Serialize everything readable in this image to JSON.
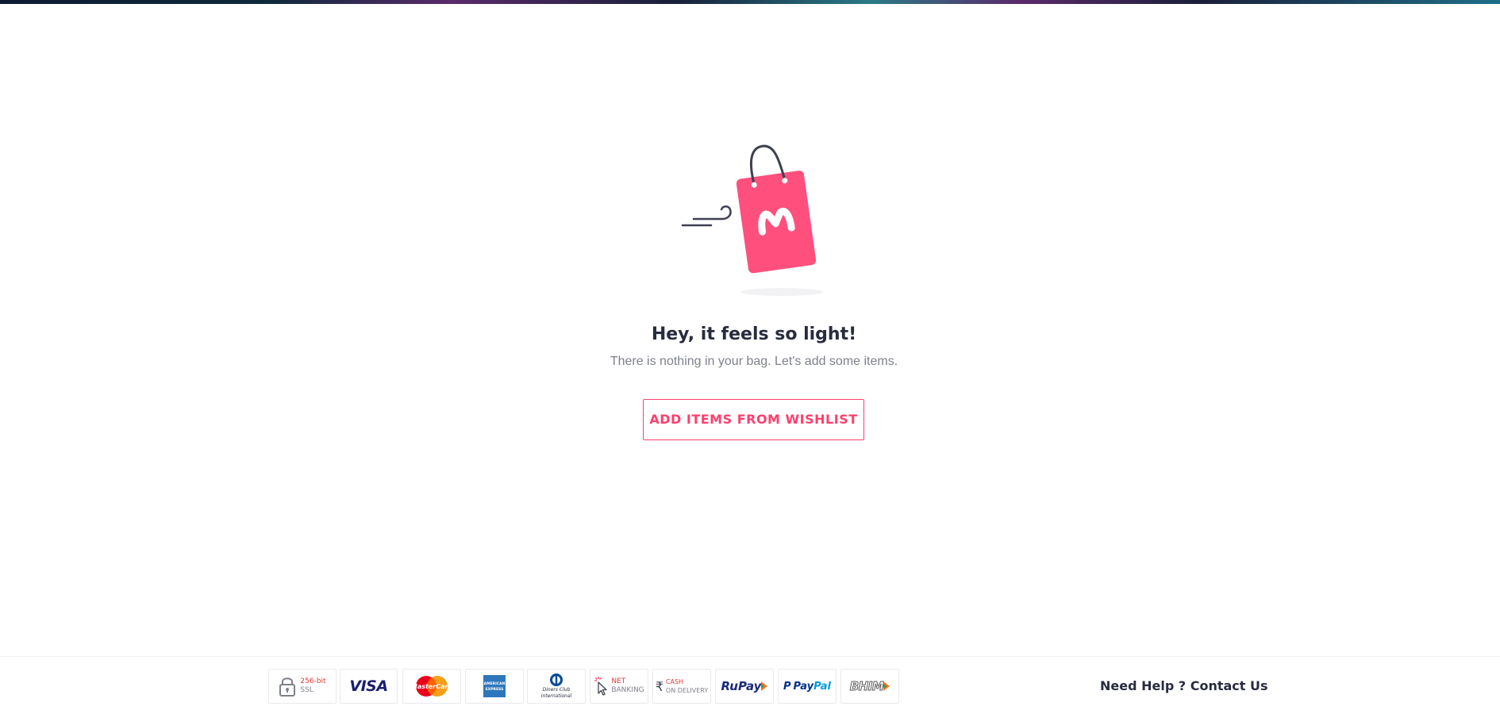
{
  "brand": {
    "accent_color": "#ff3f6c",
    "logo_letter": "M"
  },
  "empty_bag": {
    "illustration_icon": "shopping-bag-icon",
    "headline": "Hey, it feels so light!",
    "subtext": "There is nothing in your bag. Let's add some items.",
    "cta_label": "ADD ITEMS FROM WISHLIST"
  },
  "footer": {
    "payment_badges": [
      {
        "name": "ssl",
        "top": "256-bit",
        "bottom": "SSL"
      },
      {
        "name": "visa",
        "label": "VISA"
      },
      {
        "name": "mastercard",
        "label": "MasterCard"
      },
      {
        "name": "amex",
        "label": "AMERICAN EXPRESS"
      },
      {
        "name": "diners",
        "top": "Diners Club",
        "bottom": "International"
      },
      {
        "name": "netbanking",
        "top": "NET",
        "bottom": "BANKING"
      },
      {
        "name": "cod",
        "top": "CASH",
        "bottom": "ON DELIVERY"
      },
      {
        "name": "rupay",
        "label": "RuPay"
      },
      {
        "name": "paypal",
        "label_a": "Pay",
        "label_b": "Pal"
      },
      {
        "name": "bhim",
        "label": "BHIM"
      }
    ],
    "help_prefix": "Need Help ?",
    "help_link": "Contact Us"
  }
}
